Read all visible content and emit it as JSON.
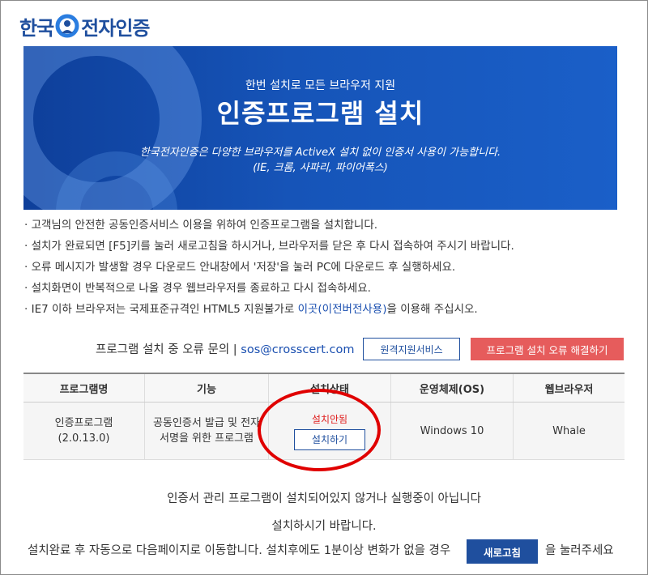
{
  "logo": {
    "left_text": "한국",
    "right_text": "전자인증"
  },
  "banner": {
    "subtitle": "한번 설치로 모든 브라우저 지원",
    "title": "인증프로그램 설치",
    "desc1": "한국전자인증은 다양한 브라우저를 ActiveX 설치 없이 인증서 사용이 가능합니다.",
    "desc2": "(IE, 크롬, 사파리, 파이어폭스)"
  },
  "notes": [
    "· 고객님의 안전한 공동인증서비스 이용을 위하여 인증프로그램을 설치합니다.",
    "· 설치가 완료되면 [F5]키를 눌러 새로고침을 하시거나, 브라우저를 닫은 후 다시 접속하여 주시기 바랍니다.",
    "· 오류 메시지가 발생할 경우 다운로드 안내창에서 '저장'을 눌러 PC에 다운로드 후 실행하세요.",
    "· 설치화면이 반복적으로 나올 경우 웹브라우저를 종료하고 다시 접속하세요."
  ],
  "note5": {
    "before": "· IE7 이하 브라우저는 국제표준규격인 HTML5 지원불가로 ",
    "link": "이곳(이전버전사용)",
    "after": "을 이용해 주십시오."
  },
  "contact": {
    "label": "프로그램 설치 중 오류 문의 | ",
    "email": "sos@crosscert.com"
  },
  "buttons": {
    "remote": "원격지원서비스",
    "error": "프로그램 설치 오류 해결하기",
    "install": "설치하기",
    "refresh": "새로고침"
  },
  "table": {
    "headers": [
      "프로그램명",
      "기능",
      "설치상태",
      "운영체제(OS)",
      "웹브라우저"
    ],
    "program_line1": "인증프로그램",
    "program_line2": "(2.0.13.0)",
    "func_line1": "공동인증서 발급 및 전자",
    "func_line2": "서명을 위한 프로그램",
    "status": "설치안됨",
    "os": "Windows 10",
    "browser": "Whale"
  },
  "message": {
    "line1": "인증서 관리 프로그램이 설치되어있지 않거나 실행중이 아닙니다",
    "line2": "설치하시기 바랍니다."
  },
  "footer": {
    "before": "설치완료 후 자동으로 다음페이지로 이동합니다. 설치후에도 1분이상 변화가 없을 경우",
    "after": "을 눌러주세요"
  },
  "colors": {
    "brand": "#1f4f9e",
    "error": "#e65c5c",
    "highlight": "#e00000"
  }
}
